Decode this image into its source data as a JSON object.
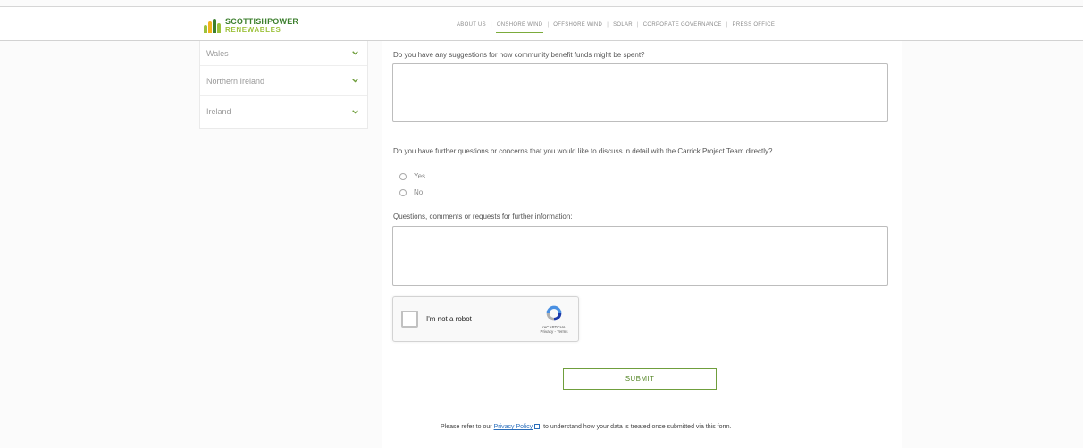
{
  "brand": {
    "line1": "SCOTTISHPOWER",
    "line2": "RENEWABLES"
  },
  "nav": [
    {
      "label": "ABOUT US",
      "active": false
    },
    {
      "label": "ONSHORE WIND",
      "active": true
    },
    {
      "label": "OFFSHORE WIND",
      "active": false
    },
    {
      "label": "SOLAR",
      "active": false
    },
    {
      "label": "CORPORATE GOVERNANCE",
      "active": false
    },
    {
      "label": "PRESS OFFICE",
      "active": false
    }
  ],
  "nav_separator": "|",
  "sidebar": {
    "items": [
      {
        "label": "Wales",
        "icon": "chevron-down-icon"
      },
      {
        "label": "Northern Ireland",
        "icon": "chevron-down-icon"
      },
      {
        "label": "Ireland",
        "icon": "chevron-down-icon"
      }
    ]
  },
  "form": {
    "q_funds": "Do you have any suggestions for how community benefit funds might be spent?",
    "q_further": "Do you have further questions or concerns that you would like to discuss in detail with the Carrick Project Team directly?",
    "option_yes": "Yes",
    "option_no": "No",
    "q_comments": "Questions, comments or requests for further information:",
    "captcha_label": "I'm not a robot",
    "captcha_brand": "reCAPTCHA",
    "captcha_links": "Privacy - Terms",
    "submit_label": "SUBMIT",
    "privacy_before": "Please refer to our",
    "privacy_link": "Privacy Policy",
    "privacy_after": "to understand how your data is treated once submitted via this form."
  },
  "colors": {
    "brand_green": "#3c7f2d",
    "brand_lime": "#9dc23c",
    "link_blue": "#2a6ebb",
    "submit_green": "#6f9e3c"
  }
}
